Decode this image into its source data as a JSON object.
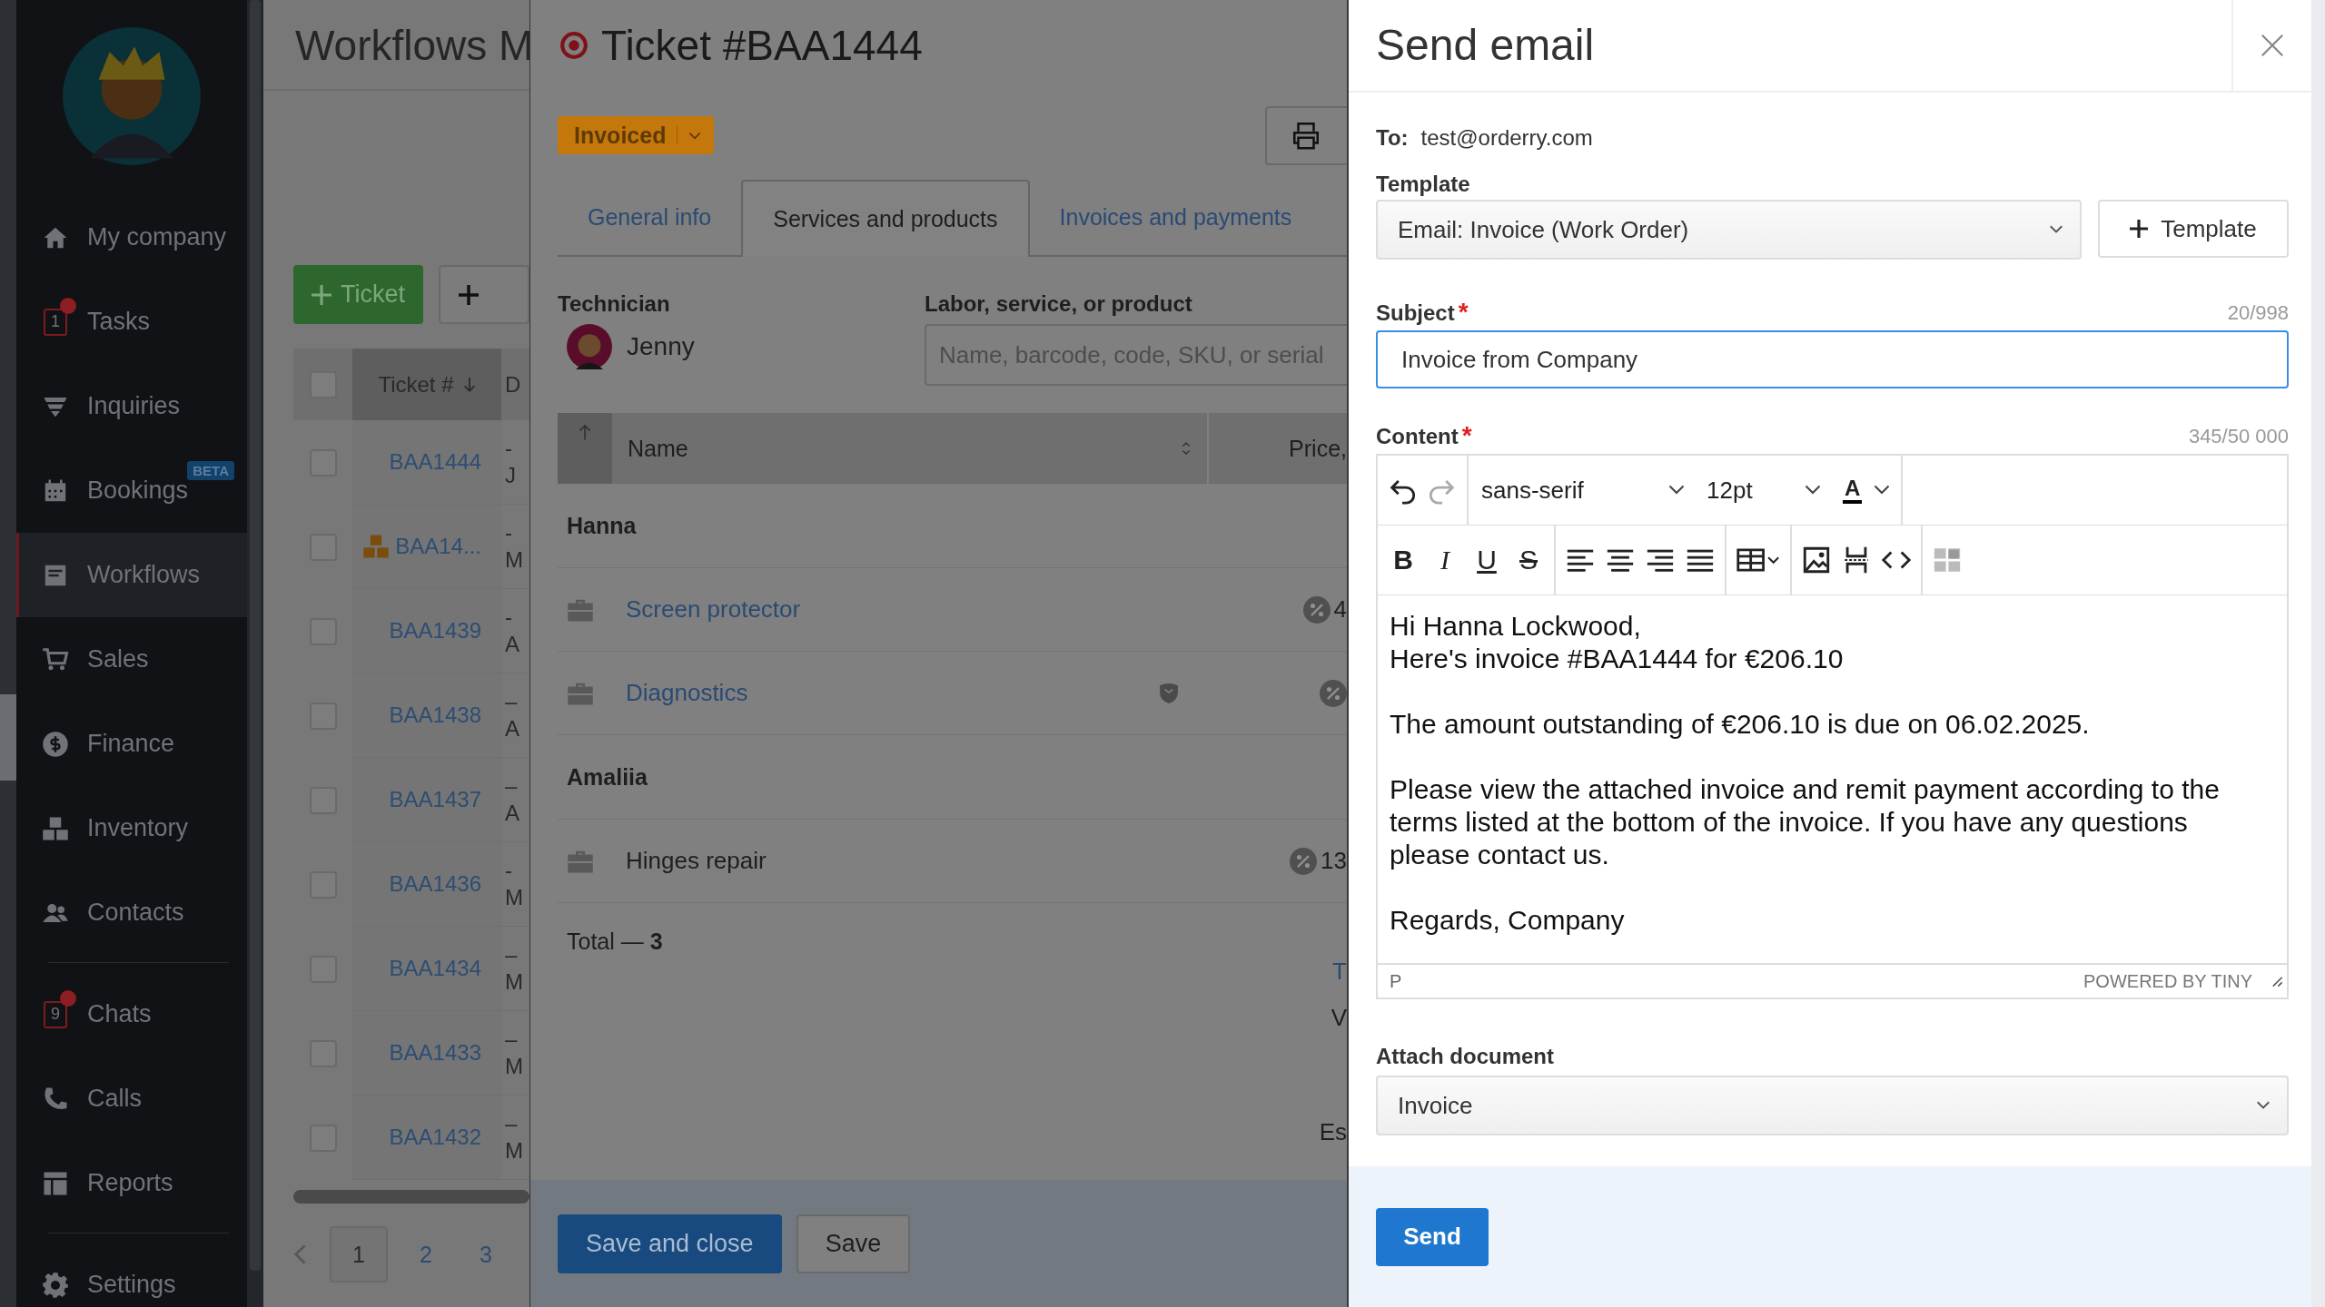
{
  "sidebar": {
    "groups": [
      [
        {
          "label": "My company",
          "selected": false
        },
        {
          "label": "Tasks",
          "selected": false,
          "count": "1"
        },
        {
          "label": "Inquiries",
          "selected": false
        },
        {
          "label": "Bookings",
          "selected": false,
          "tag": "BETA"
        },
        {
          "label": "Workflows",
          "selected": true
        },
        {
          "label": "Sales",
          "selected": false
        },
        {
          "label": "Finance",
          "selected": false
        },
        {
          "label": "Inventory",
          "selected": false
        },
        {
          "label": "Contacts",
          "selected": false
        }
      ],
      [
        {
          "label": "Chats",
          "selected": false,
          "count": "9"
        },
        {
          "label": "Calls",
          "selected": false
        },
        {
          "label": "Reports",
          "selected": false
        }
      ],
      [
        {
          "label": "Settings",
          "selected": false
        }
      ]
    ]
  },
  "workflows": {
    "title": "Workflows M",
    "new_ticket_button": "Ticket",
    "table": {
      "columns": [
        "Ticket #",
        "D"
      ],
      "all_checked": false,
      "rows": [
        {
          "ticket": "BAA1444",
          "kind": "plain",
          "checked": false,
          "column_2": [
            "-",
            "J"
          ]
        },
        {
          "ticket": "BAA14...",
          "kind": "bundle",
          "checked": false,
          "column_2": [
            "-",
            "M"
          ]
        },
        {
          "ticket": "BAA1439",
          "kind": "plain",
          "checked": false,
          "column_2": [
            "-",
            "A"
          ]
        },
        {
          "ticket": "BAA1438",
          "kind": "plain",
          "checked": false,
          "column_2": [
            "–",
            "A"
          ]
        },
        {
          "ticket": "BAA1437",
          "kind": "plain",
          "checked": false,
          "column_2": [
            "–",
            "A"
          ]
        },
        {
          "ticket": "BAA1436",
          "kind": "plain",
          "checked": false,
          "column_2": [
            "-",
            "M"
          ]
        },
        {
          "ticket": "BAA1434",
          "kind": "plain",
          "checked": false,
          "column_2": [
            "–",
            "M"
          ]
        },
        {
          "ticket": "BAA1433",
          "kind": "plain",
          "checked": false,
          "column_2": [
            "–",
            "M"
          ]
        },
        {
          "ticket": "BAA1432",
          "kind": "plain",
          "checked": false,
          "column_2": [
            "–",
            "M"
          ]
        }
      ]
    },
    "pagination": [
      {
        "label": "1",
        "selected": true
      },
      {
        "label": "2",
        "selected": false
      },
      {
        "label": "3",
        "selected": false
      }
    ]
  },
  "ticket": {
    "title": "Ticket #BAA1444",
    "status": "Invoiced",
    "tabs": [
      {
        "label": "General info",
        "selected": false
      },
      {
        "label": "Services and products",
        "selected": true
      },
      {
        "label": "Invoices and payments",
        "selected": false
      }
    ],
    "technician_label": "Technician",
    "technician": "Jenny",
    "search_label": "Labor, service, or product",
    "search_placeholder": "Name, barcode, code, SKU, or serial",
    "columns": [
      "Name",
      "Price,"
    ],
    "groups": [
      {
        "name": "Hanna",
        "items": [
          {
            "name": "Screen protector",
            "linked": true,
            "warranty": false,
            "price": "4"
          },
          {
            "name": "Diagnostics",
            "linked": true,
            "warranty": true
          }
        ]
      },
      {
        "name": "Amaliia",
        "items": [
          {
            "name": "Hinges repair",
            "linked": false,
            "warranty": false,
            "price": "13"
          }
        ]
      }
    ],
    "total": "Total — 3",
    "summary_fragments": [
      "T",
      "V",
      "Es"
    ],
    "buttons": [
      "Save and close",
      "Save"
    ]
  },
  "email": {
    "title": "Send email",
    "to_label": "To:",
    "to": "test@orderry.com",
    "template_label": "Template",
    "template_value": "Email: Invoice (Work Order)",
    "template_button": "Template",
    "subject_label": "Subject",
    "subject_mark": "*",
    "subject_counter": "20/998",
    "subject_value": "Invoice from Company",
    "content_label": "Content",
    "content_mark": "*",
    "content_counter": "345/50 000",
    "editor": {
      "font": "sans-serif",
      "size": "12pt",
      "color_button": "A",
      "format_buttons": [
        {
          "label": "B",
          "kind": "bold"
        },
        {
          "label": "I",
          "kind": "italic"
        },
        {
          "label": "U",
          "kind": "underline"
        },
        {
          "label": "S",
          "kind": "strike"
        }
      ],
      "body": [
        [
          "Hi Hanna Lockwood,",
          "Here's invoice #BAA1444 for €206.10"
        ],
        [
          "The amount outstanding of €206.10 is due on 06.02.2025."
        ],
        [
          "Please view the attached invoice and remit payment according to the",
          "terms listed at the bottom of the invoice. If you have any questions",
          "please contact us."
        ],
        [
          "Regards, Company"
        ]
      ],
      "path": "P",
      "branding": "POWERED BY TINY"
    },
    "attach_label": "Attach document",
    "attach_value": "Invoice",
    "send_button": "Send"
  }
}
